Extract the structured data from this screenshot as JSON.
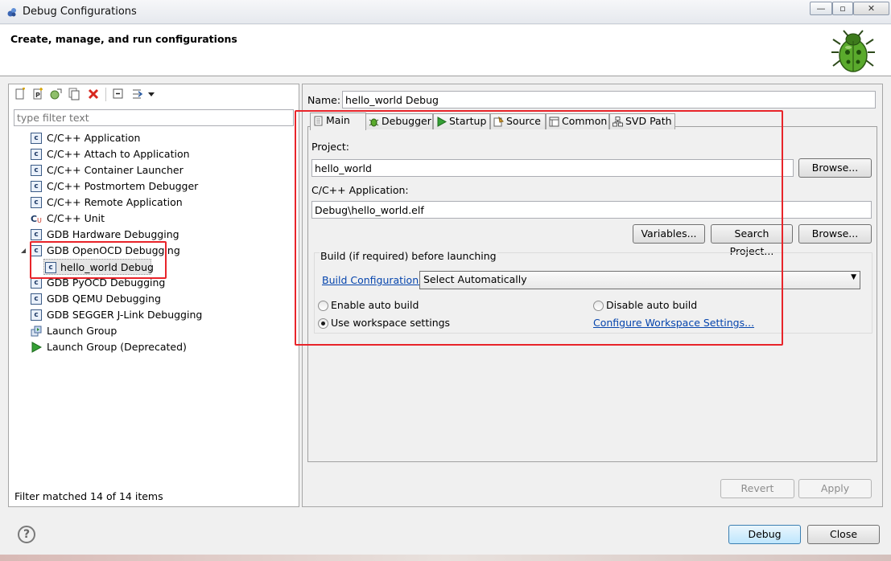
{
  "window": {
    "title": "Debug Configurations",
    "controls": {
      "minimize": "—",
      "maximize": "▫",
      "close": "✕"
    }
  },
  "header": {
    "text": "Create, manage, and run configurations",
    "icon": "bug-icon"
  },
  "left_panel": {
    "toolbar": [
      "new-config-icon",
      "new-prototype-icon",
      "export-icon",
      "duplicate-icon",
      "delete-icon",
      "collapse-all-icon",
      "filter-icon",
      "dropdown-arrow-icon"
    ],
    "filter_placeholder": "type filter text",
    "tree": [
      {
        "label": "C/C++ Application",
        "icon": "c-config-icon"
      },
      {
        "label": "C/C++ Attach to Application",
        "icon": "c-config-icon"
      },
      {
        "label": "C/C++ Container Launcher",
        "icon": "c-config-icon"
      },
      {
        "label": "C/C++ Postmortem Debugger",
        "icon": "c-config-icon"
      },
      {
        "label": "C/C++ Remote Application",
        "icon": "c-config-icon"
      },
      {
        "label": "C/C++ Unit",
        "icon": "c-unit-icon"
      },
      {
        "label": "GDB Hardware Debugging",
        "icon": "c-config-icon"
      },
      {
        "label": "GDB OpenOCD Debugging",
        "icon": "c-config-icon",
        "expanded": true
      },
      {
        "label": "hello_world Debug",
        "icon": "c-config-icon",
        "child": true,
        "selected": true
      },
      {
        "label": "GDB PyOCD Debugging",
        "icon": "c-config-icon"
      },
      {
        "label": "GDB QEMU Debugging",
        "icon": "c-config-icon"
      },
      {
        "label": "GDB SEGGER J-Link Debugging",
        "icon": "c-config-icon"
      },
      {
        "label": "Launch Group",
        "icon": "launch-group-icon"
      },
      {
        "label": "Launch Group (Deprecated)",
        "icon": "run-icon"
      }
    ],
    "status": "Filter matched 14 of 14 items"
  },
  "right_panel": {
    "name_label": "Name:",
    "name_value": "hello_world Debug",
    "tabs": [
      {
        "label": "Main",
        "icon": "main-tab-icon",
        "active": true
      },
      {
        "label": "Debugger",
        "icon": "debugger-tab-icon"
      },
      {
        "label": "Startup",
        "icon": "startup-tab-icon"
      },
      {
        "label": "Source",
        "icon": "source-tab-icon"
      },
      {
        "label": "Common",
        "icon": "common-tab-icon"
      },
      {
        "label": "SVD Path",
        "icon": "svd-tab-icon"
      }
    ],
    "main": {
      "project_label": "Project:",
      "project_value": "hello_world",
      "browse_label": "Browse...",
      "app_label": "C/C++ Application:",
      "app_value": "Debug\\hello_world.elf",
      "variables_label": "Variables...",
      "search_project_label": "Search Project...",
      "browse2_label": "Browse...",
      "build_group_title": "Build (if required) before launching",
      "build_config_link": "Build Configuration:",
      "build_config_value": "Select Automatically",
      "enable_auto_build": "Enable auto build",
      "disable_auto_build": "Disable auto build",
      "use_workspace": "Use workspace settings",
      "configure_workspace_link": "Configure Workspace Settings..."
    },
    "revert_label": "Revert",
    "apply_label": "Apply"
  },
  "bottom": {
    "help": "?",
    "debug_label": "Debug",
    "close_label": "Close"
  },
  "colors": {
    "annotation": "#e8242a",
    "link": "#0645ad"
  }
}
